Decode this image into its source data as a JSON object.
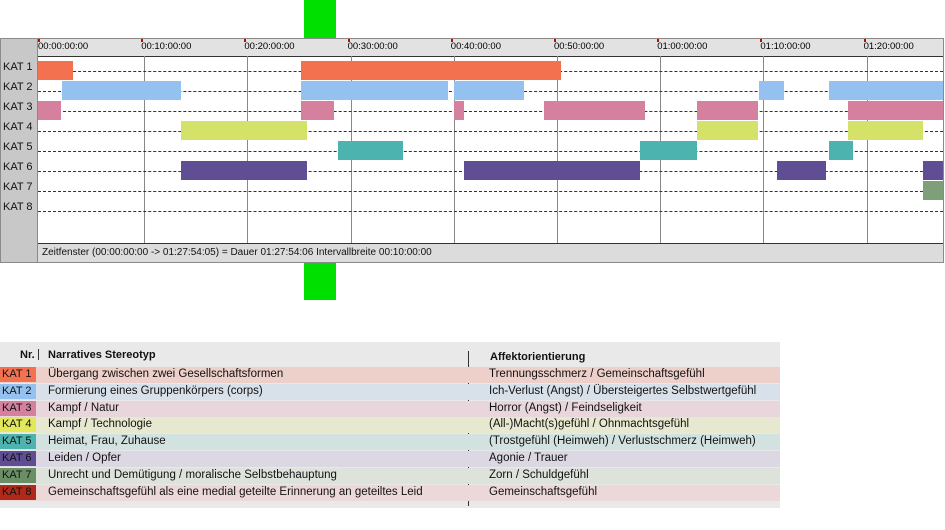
{
  "timeline": {
    "ticks": [
      "00:00:00:00",
      "00:10:00:00",
      "00:20:00:00",
      "00:30:00:00",
      "00:40:00:00",
      "00:50:00:00",
      "01:00:00:00",
      "01:10:00:00",
      "01:20:00:00"
    ],
    "status": "Zeitfenster (00:00:00:00 -> 01:27:54:05) = Dauer 01:27:54:06    Intervallbreite 00:10:00:00",
    "rows": [
      {
        "label": "KAT 1",
        "color": "#f4714f",
        "segments": [
          [
            0,
            3.4
          ],
          [
            25.5,
            50.7
          ]
        ]
      },
      {
        "label": "KAT 2",
        "color": "#95c1f0",
        "segments": [
          [
            2.3,
            13.9
          ],
          [
            25.5,
            39.7
          ],
          [
            40.3,
            47.1
          ],
          [
            69.9,
            72.3
          ],
          [
            76.6,
            87.9
          ]
        ]
      },
      {
        "label": "KAT 3",
        "color": "#d4809e",
        "segments": [
          [
            0,
            2.2
          ],
          [
            25.5,
            28.7
          ],
          [
            40.3,
            41.3
          ],
          [
            49.0,
            58.8
          ],
          [
            63.9,
            69.8
          ],
          [
            78.5,
            87.9
          ]
        ]
      },
      {
        "label": "KAT 4",
        "color": "#d4e26a",
        "segments": [
          [
            13.9,
            26.1
          ],
          [
            63.9,
            69.8
          ],
          [
            78.5,
            85.8
          ]
        ]
      },
      {
        "label": "KAT 5",
        "color": "#4cb3af",
        "segments": [
          [
            29.1,
            35.4
          ],
          [
            58.3,
            63.9
          ],
          [
            76.6,
            79.0
          ]
        ]
      },
      {
        "label": "KAT 6",
        "color": "#5f4e94",
        "segments": [
          [
            13.9,
            26.1
          ],
          [
            41.3,
            58.3
          ],
          [
            71.6,
            76.4
          ],
          [
            85.8,
            87.9
          ]
        ]
      },
      {
        "label": "KAT 7",
        "color": "#7f9f7a",
        "segments": [
          [
            85.8,
            87.9
          ]
        ]
      },
      {
        "label": "KAT 8",
        "color": "#b02a1a",
        "segments": []
      }
    ]
  },
  "legend": {
    "col_nr": "Nr.",
    "col_stereotype": "Narratives Stereotyp",
    "col_affect": "Affektorientierung",
    "rows": [
      {
        "nr": "KAT 1",
        "badge_color": "#f4714f",
        "row_color": "#ecd0c9",
        "stereotype": "Übergang zwischen zwei Gesellschaftsformen",
        "affect": "Trennungsschmerz / Gemeinschaftsgefühl"
      },
      {
        "nr": "KAT 2",
        "badge_color": "#95c1f0",
        "row_color": "#d8e0ea",
        "stereotype": "Formierung eines Gruppenkörpers (corps)",
        "affect": "Ich-Verlust (Angst) / Übersteigertes Selbstwertgefühl"
      },
      {
        "nr": "KAT 3",
        "badge_color": "#d4809e",
        "row_color": "#e8d6dc",
        "stereotype": "Kampf / Natur",
        "affect": "Horror (Angst) / Feindseligkeit"
      },
      {
        "nr": "KAT 4",
        "badge_color": "#e2e85a",
        "row_color": "#e6e8cf",
        "stereotype": "Kampf / Technologie",
        "affect": "(All-)Macht(s)gefühl / Ohnmachtsgefühl"
      },
      {
        "nr": "KAT 5",
        "badge_color": "#4cb3af",
        "row_color": "#d2e2e0",
        "stereotype": "Heimat, Frau, Zuhause",
        "affect": "(Trostgefühl (Heimweh) / Verlustschmerz (Heimweh)"
      },
      {
        "nr": "KAT 6",
        "badge_color": "#5f4e94",
        "row_color": "#dbd8e3",
        "stereotype": "Leiden / Opfer",
        "affect": "Agonie / Trauer"
      },
      {
        "nr": "KAT 7",
        "badge_color": "#6a8f66",
        "row_color": "#dde3db",
        "stereotype": "Unrecht und Demütigung / moralische Selbstbehauptung",
        "affect": "Zorn / Schuldgefühl"
      },
      {
        "nr": "KAT 8",
        "badge_color": "#b02a1a",
        "row_color": "#ecd8d8",
        "stereotype": "Gemeinschaftsgefühl als eine medial geteilte Erinnerung an geteiltes Leid",
        "affect": "Gemeinschaftsgefühl"
      }
    ]
  }
}
